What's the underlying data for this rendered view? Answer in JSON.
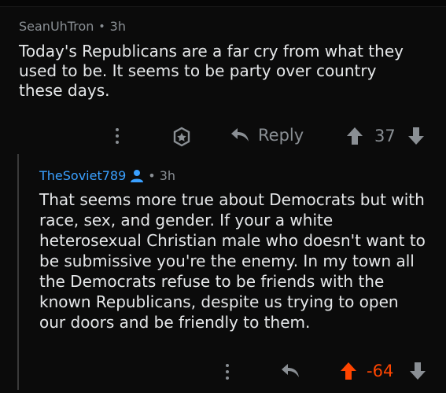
{
  "comments": [
    {
      "username": "SeanUhTron",
      "age": "3h",
      "text": "Today's Republicans are a far cry from what they used to be. It seems to be party over country these days.",
      "reply_label": "Reply",
      "score": "37"
    },
    {
      "username": "TheSoviet789",
      "age": "3h",
      "text": "That seems more true about Democrats but with race, sex, and gender. If your a white heterosexual Christian male who doesn't want to be submissive you're the enemy. In my town all the Democrats refuse to be friends with the known Republicans, despite us trying to open our doors and be friendly to them.",
      "score": "-64"
    }
  ],
  "colors": {
    "background": "#0b0b0b",
    "text": "#e6e8ea",
    "meta": "#8a8f94",
    "username_link": "#3aa0ff",
    "downvoted": "#ff4500"
  },
  "icons": [
    "more-icon",
    "award-icon",
    "reply-icon",
    "upvote-icon",
    "downvote-icon",
    "user-icon"
  ]
}
